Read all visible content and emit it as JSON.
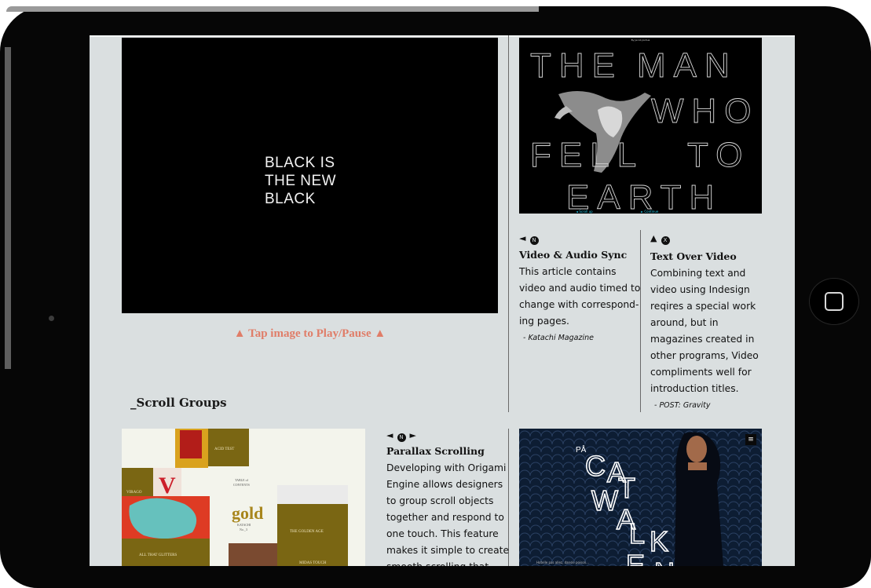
{
  "main_video": {
    "lines": [
      "BLACK IS",
      "THE NEW",
      "BLACK"
    ]
  },
  "tap_caption": "▲ Tap image to Play/Pause ▲",
  "section_title": "_Scroll Groups",
  "poster": {
    "byline": "By Jacob Joshua",
    "words": [
      "THE",
      "MAN",
      "WHO",
      "FELL",
      "TO",
      "EARTH"
    ],
    "nav_left": "◄ Scroll up",
    "nav_right": "► Continue"
  },
  "feature_video_audio": {
    "controls": "◄",
    "icon": "N",
    "title": "Video & Audio Sync",
    "body": [
      "This article contains",
      "video and audio timed to",
      "change with correspond-",
      "ing pages."
    ],
    "credit": "- Katachi Magazine"
  },
  "feature_text_over_video": {
    "controls": "▲",
    "icon": "X",
    "title": "Text Over Video",
    "body": [
      "Combining text and",
      "video using Indesign",
      "reqires a special work",
      "around, but in",
      "magazines created in",
      "other programs,  Video",
      "compliments well for",
      "introduction titles."
    ],
    "credit": "- POST: Gravity"
  },
  "feature_parallax": {
    "controls_left": "◄",
    "icon": "N",
    "controls_right": "►",
    "title": "Parallax Scrolling",
    "body": [
      "Developing with Origami",
      "Engine allows designers",
      "to group scroll objects",
      "together and respond to",
      "one touch. This feature",
      "makes it simple to create",
      "smooth scrolling that..."
    ]
  },
  "scroll_art": {
    "tile_acid": "ACID TEST",
    "tile_virago": "VIRAGO",
    "toc_top": "TABLE of",
    "toc_mid": "CONTENTS",
    "toc_gold": "gold",
    "toc_katachi": "KATACHI",
    "toc_no": "No._3",
    "tile_golden_age": "THE GOLDEN AGE",
    "tile_glitters": "ALL THAT GLITTERS",
    "tile_midas": "MIDAS TOUCH"
  },
  "fashion": {
    "pa": "PÅ",
    "title_letters": [
      "C",
      "A",
      "T",
      "W",
      "A",
      "L",
      "K",
      "E",
      "N"
    ],
    "menu_icon": "≡",
    "bottom_caption": "Hotelle pas allez, dansle poison..."
  }
}
